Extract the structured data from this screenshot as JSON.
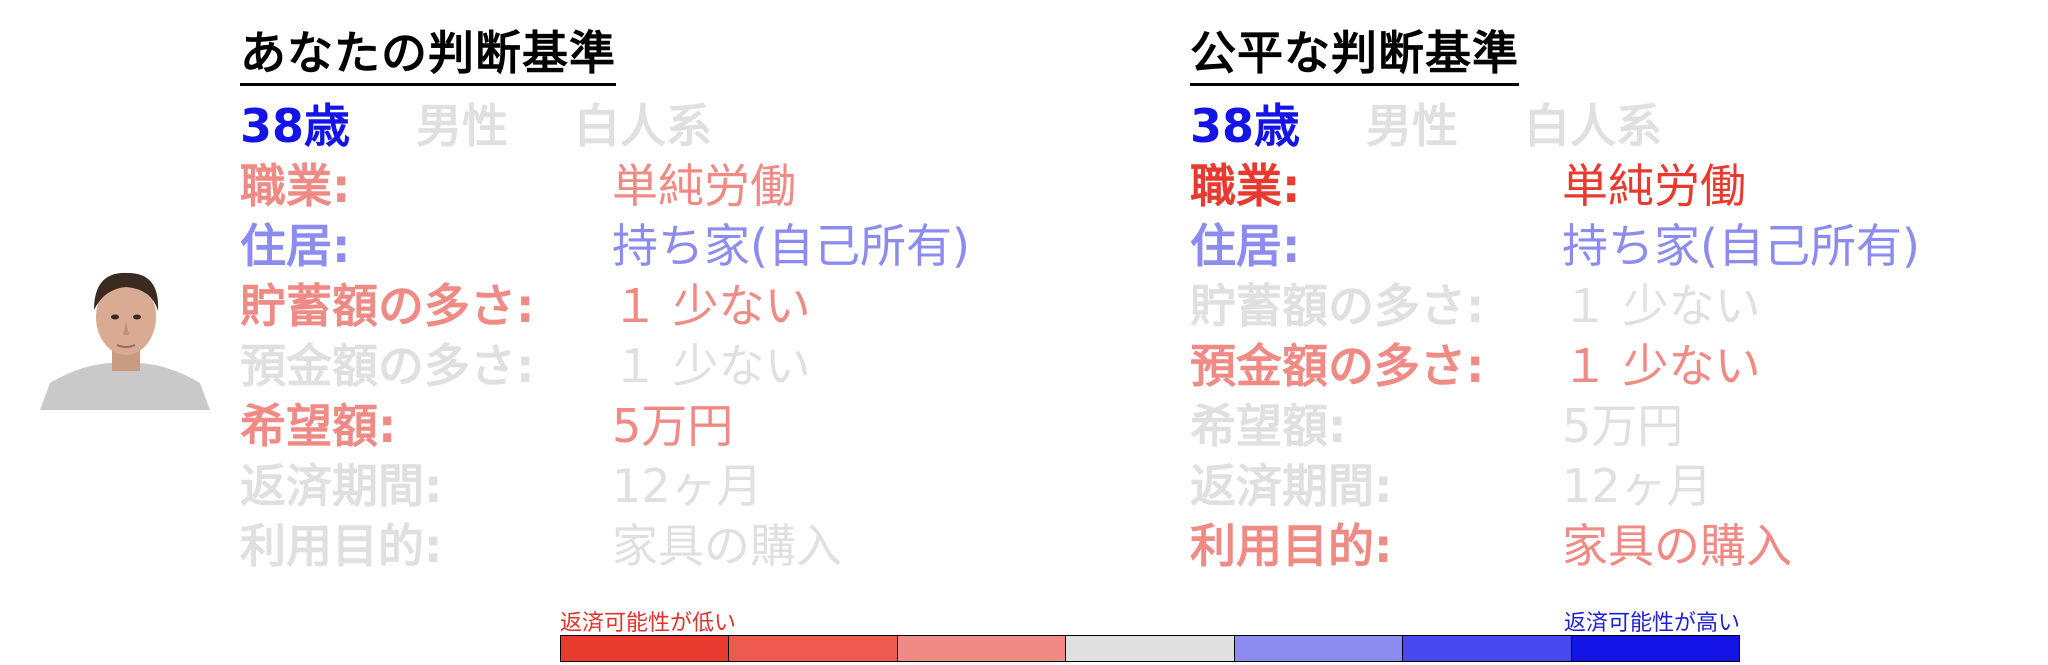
{
  "palette": {
    "strong_red": "#e83a2f",
    "mid_red": "#f08a84",
    "gray": "#e0e0e0",
    "mid_blue": "#8c8cf0",
    "strong_blue": "#1414e6"
  },
  "left_panel": {
    "title": "あなたの判断基準",
    "demographics": [
      {
        "text": "38歳",
        "color": "#1414e6"
      },
      {
        "text": "男性",
        "color": "#e0e0e0"
      },
      {
        "text": "白人系",
        "color": "#e0e0e0"
      }
    ],
    "rows": [
      {
        "label": "職業:",
        "value": "単純労働",
        "color": "#f08a84"
      },
      {
        "label": "住居:",
        "value": "持ち家(自己所有)",
        "color": "#8c8cf0"
      },
      {
        "label": "貯蓄額の多さ:",
        "value": "１ 少ない",
        "color": "#f08a84"
      },
      {
        "label": "預金額の多さ:",
        "value": "１ 少ない",
        "color": "#e0e0e0"
      },
      {
        "label": "希望額:",
        "value": "5万円",
        "color": "#f08a84"
      },
      {
        "label": "返済期間:",
        "value": "12ヶ月",
        "color": "#e0e0e0"
      },
      {
        "label": "利用目的:",
        "value": "家具の購入",
        "color": "#e0e0e0"
      }
    ]
  },
  "right_panel": {
    "title": "公平な判断基準",
    "demographics": [
      {
        "text": "38歳",
        "color": "#1414e6"
      },
      {
        "text": "男性",
        "color": "#e0e0e0"
      },
      {
        "text": "白人系",
        "color": "#e0e0e0"
      }
    ],
    "rows": [
      {
        "label": "職業:",
        "value": "単純労働",
        "color": "#e83a2f"
      },
      {
        "label": "住居:",
        "value": "持ち家(自己所有)",
        "color": "#8c8cf0"
      },
      {
        "label": "貯蓄額の多さ:",
        "value": "１ 少ない",
        "color": "#e0e0e0"
      },
      {
        "label": "預金額の多さ:",
        "value": "１ 少ない",
        "color": "#f08a84"
      },
      {
        "label": "希望額:",
        "value": "5万円",
        "color": "#e0e0e0"
      },
      {
        "label": "返済期間:",
        "value": "12ヶ月",
        "color": "#e0e0e0"
      },
      {
        "label": "利用目的:",
        "value": "家具の購入",
        "color": "#f08a84"
      }
    ]
  },
  "legend": {
    "low_label": "返済可能性が低い",
    "high_label": "返済可能性が高い",
    "scale_colors": [
      "#e83a2f",
      "#ee5a50",
      "#f08a84",
      "#e0e0e0",
      "#8c8cf0",
      "#4848ee",
      "#1414e6"
    ]
  }
}
